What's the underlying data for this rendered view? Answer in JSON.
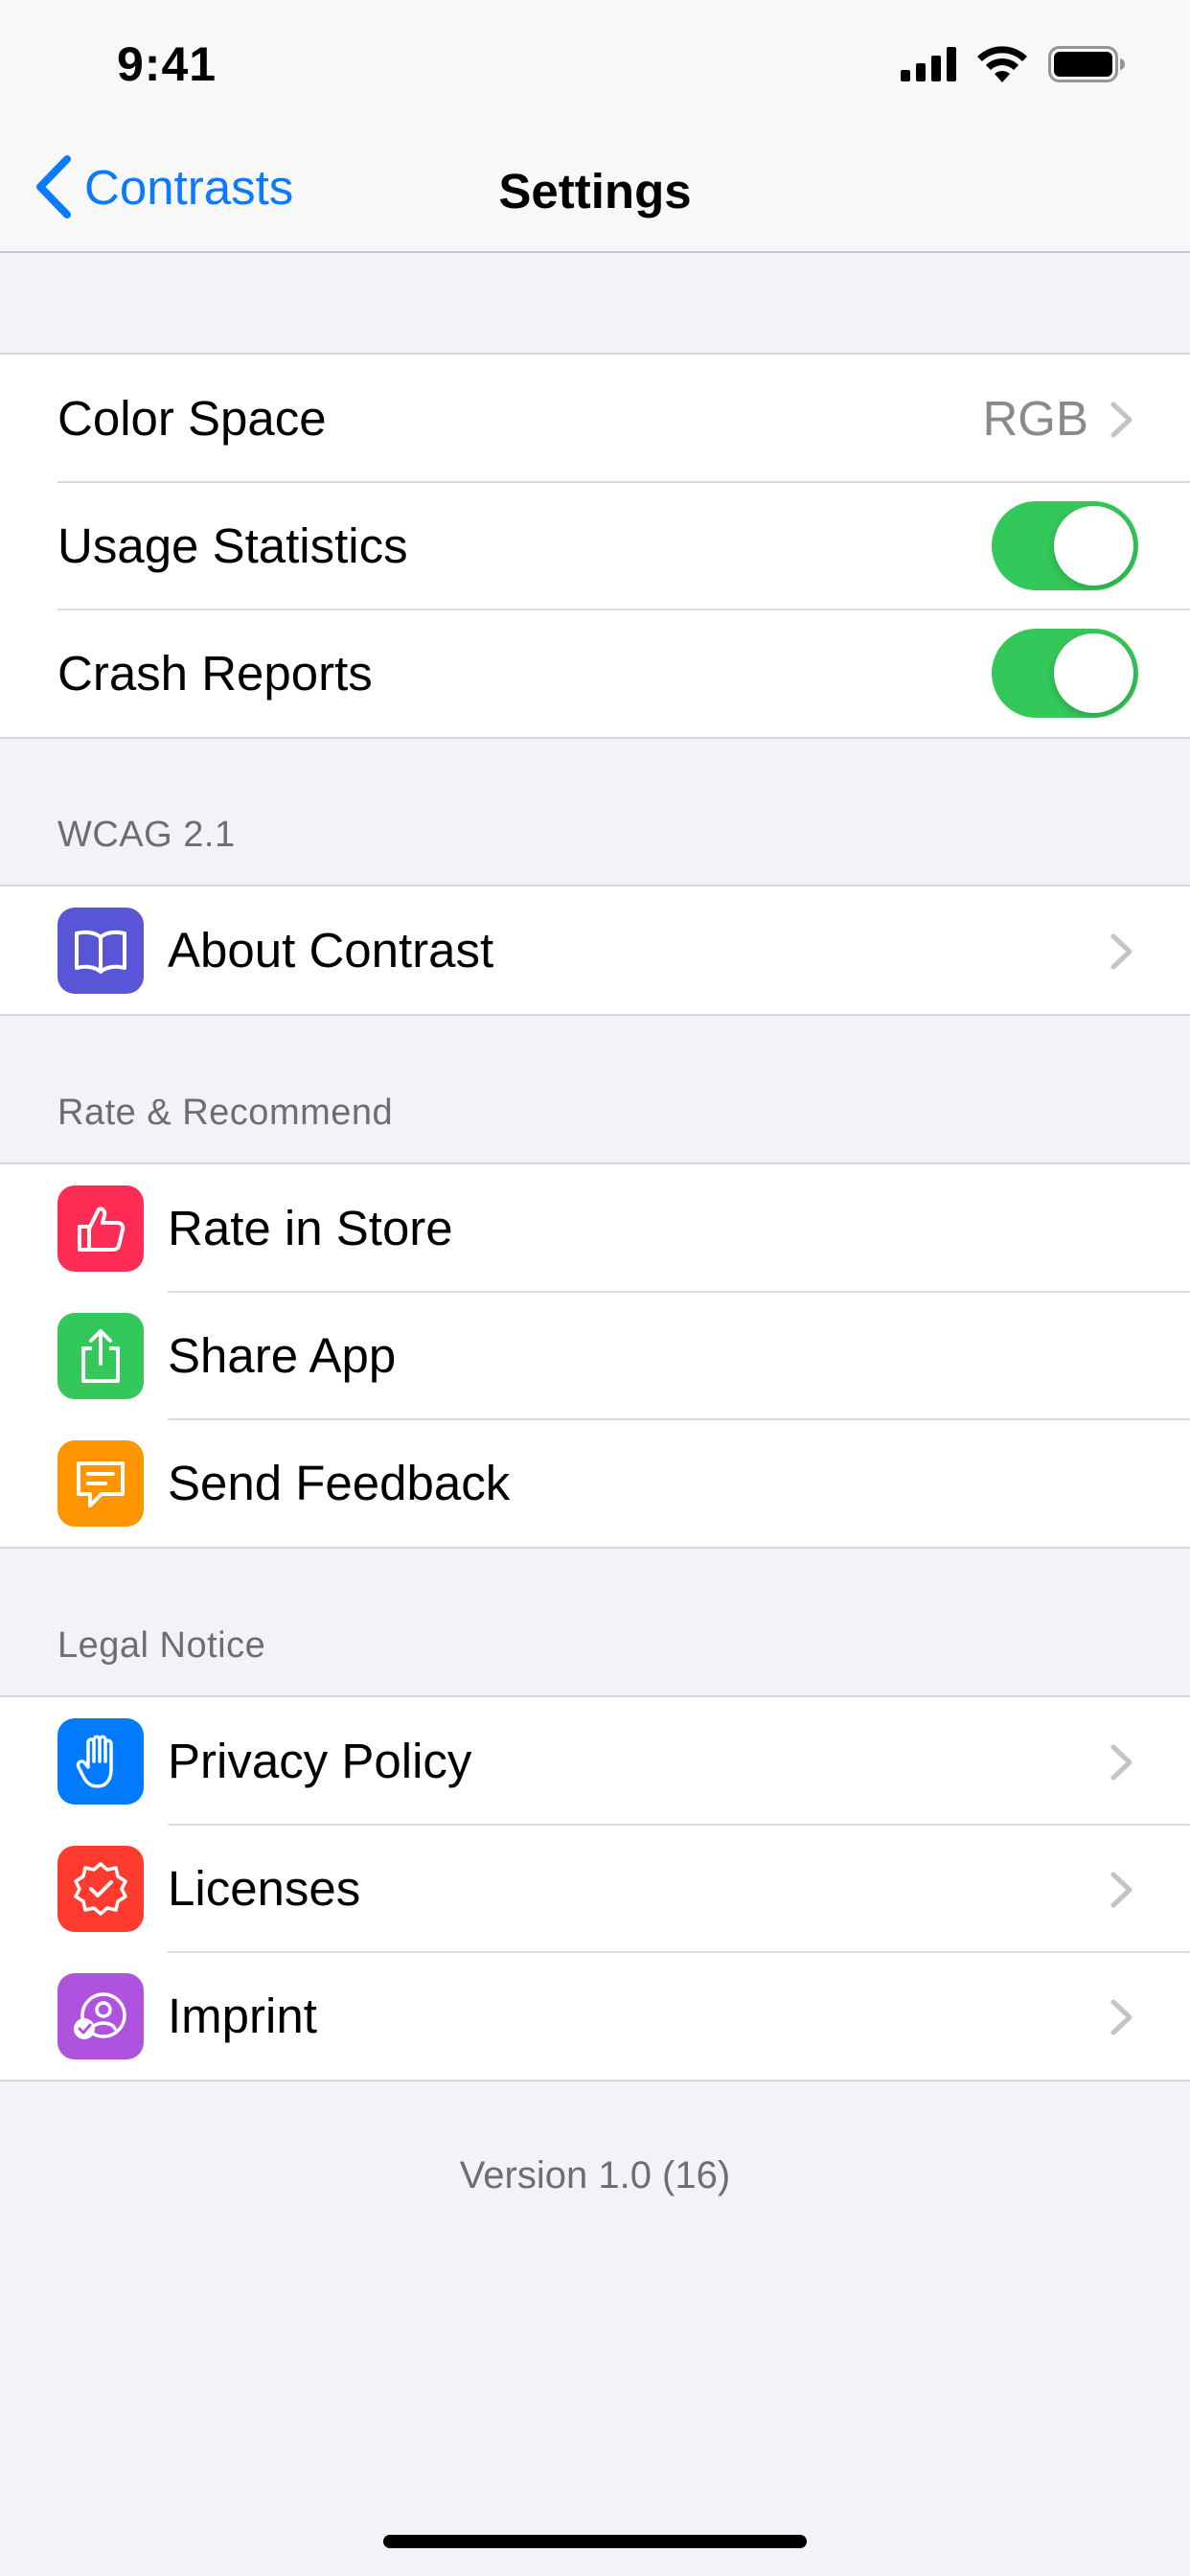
{
  "status_bar": {
    "time": "9:41"
  },
  "nav": {
    "back_label": "Contrasts",
    "title": "Settings"
  },
  "general": {
    "color_space_label": "Color Space",
    "color_space_value": "RGB",
    "usage_statistics_label": "Usage Statistics",
    "usage_statistics_on": true,
    "crash_reports_label": "Crash Reports",
    "crash_reports_on": true
  },
  "wcag": {
    "header": "WCAG 2.1",
    "about_label": "About Contrast"
  },
  "rate": {
    "header": "Rate & Recommend",
    "rate_label": "Rate in Store",
    "share_label": "Share App",
    "feedback_label": "Send Feedback"
  },
  "legal": {
    "header": "Legal Notice",
    "privacy_label": "Privacy Policy",
    "licenses_label": "Licenses",
    "imprint_label": "Imprint"
  },
  "footer": {
    "version": "Version 1.0 (16)"
  },
  "colors": {
    "accent": "#0a7aff",
    "toggle_on": "#34c759",
    "about_icon_bg": "#5856d6",
    "rate_icon_bg": "#ff2d55",
    "share_icon_bg": "#34c759",
    "feedback_icon_bg": "#ff9500",
    "privacy_icon_bg": "#007aff",
    "licenses_icon_bg": "#ff3b30",
    "imprint_icon_bg": "#af52de"
  },
  "icons": {
    "about": "book-icon",
    "rate": "thumbs-up-icon",
    "share": "share-icon",
    "feedback": "message-icon",
    "privacy": "hand-icon",
    "licenses": "badge-check-icon",
    "imprint": "person-check-icon"
  }
}
